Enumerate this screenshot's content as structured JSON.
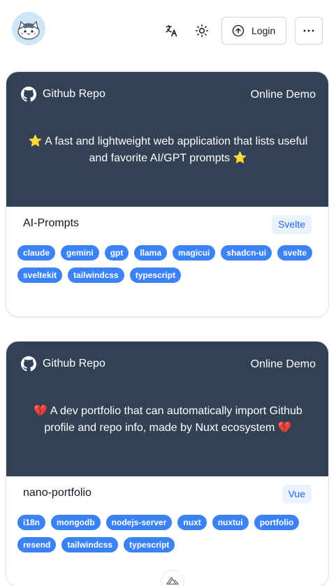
{
  "header": {
    "login_label": "Login",
    "more_label": "···"
  },
  "icons": {
    "translate": "translate-icon",
    "theme": "sun-icon",
    "login": "arrow-up-circle-icon",
    "github": "github-icon",
    "scroll_top": "nuxt-logo-icon"
  },
  "colors": {
    "banner": "#334155",
    "tag": "#3b82f6",
    "badge_bg": "#eaf2fe",
    "badge_text": "#2563eb"
  },
  "cards": [
    {
      "repo_label": "Github Repo",
      "demo_label": "Online Demo",
      "description": "⭐ A fast and lightweight web application that lists useful and favorite AI/GPT prompts ⭐",
      "name": "AI-Prompts",
      "framework": "Svelte",
      "tags": [
        "claude",
        "gemini",
        "gpt",
        "llama",
        "magicui",
        "shadcn-ui",
        "svelte",
        "sveltekit",
        "tailwindcss",
        "typescript"
      ]
    },
    {
      "repo_label": "Github Repo",
      "demo_label": "Online Demo",
      "description": "💔 A dev portfolio that can automatically import Github profile and repo info, made by Nuxt ecosystem 💔",
      "name": "nano-portfolio",
      "framework": "Vue",
      "tags": [
        "i18n",
        "mongodb",
        "nodejs-server",
        "nuxt",
        "nuxtui",
        "portfolio",
        "resend",
        "tailwindcss",
        "typescript"
      ]
    }
  ]
}
